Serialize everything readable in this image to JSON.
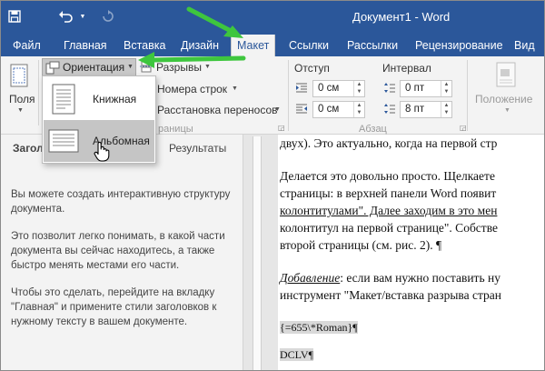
{
  "window": {
    "title": "Документ1 - Word"
  },
  "qat": {
    "save_icon": "save-icon",
    "undo_icon": "undo-icon",
    "redo_icon": "redo-icon"
  },
  "tabs": [
    {
      "label": "Файл"
    },
    {
      "label": "Главная"
    },
    {
      "label": "Вставка"
    },
    {
      "label": "Дизайн"
    },
    {
      "label": "Макет",
      "active": true
    },
    {
      "label": "Ссылки"
    },
    {
      "label": "Рассылки"
    },
    {
      "label": "Рецензирование"
    },
    {
      "label": "Вид"
    }
  ],
  "ribbon": {
    "margins_label": "Поля",
    "orientation_label": "Ориентация",
    "breaks_label": "Разрывы",
    "line_numbers_label": "Номера строк",
    "hyphenation_label": "Расстановка переносов",
    "page_setup_group_fragment": "раницы",
    "indent_header": "Отступ",
    "spacing_header": "Интервал",
    "indent_left_value": "0 см",
    "indent_right_value": "0 см",
    "spacing_before_value": "0 пт",
    "spacing_after_value": "8 пт",
    "paragraph_group_label": "Абзац",
    "position_label": "Положение"
  },
  "orientation_menu": {
    "items": [
      {
        "label": "Книжная",
        "icon": "portrait-page-icon"
      },
      {
        "label": "Альбомная",
        "icon": "landscape-page-icon",
        "highlighted": true
      }
    ]
  },
  "navpane": {
    "tab_headings_fragment": "Загол",
    "tab_results": "Результаты",
    "p1": "Вы можете создать интерактивную структуру документа.",
    "p2": "Это позволит легко понимать, в какой части документа вы сейчас находитесь, а также быстро менять местами его части.",
    "p3": "Чтобы это сделать, перейдите на вкладку \"Главная\" и примените стили заголовков к нужному тексту в вашем документе."
  },
  "document": {
    "line1": "двух). Это актуально, когда на первой стр",
    "line2": "Делается это довольно просто. Щелкаете",
    "line3": "страницы: в верхней панели Word появит",
    "line4": "колонтитулами\". Далее заходим в это мен",
    "line5": "колонтитул на первой странице\". Собстве",
    "line6": "второй страницы (см. рис. 2). ¶",
    "line7_italic": "Добавление",
    "line7_rest": ": если вам нужно поставить ну",
    "line8": "инструмент \"Макет/вставка разрыва стран",
    "field_code": "{=655\\*Roman}¶",
    "field_result": "DCLV¶"
  },
  "colors": {
    "word_blue": "#2b579a",
    "annotation_green": "#3ec63e",
    "ribbon_bg": "#f3f3f3"
  }
}
